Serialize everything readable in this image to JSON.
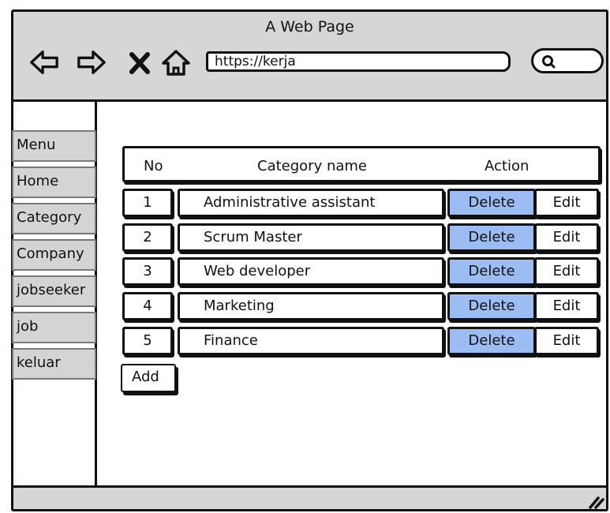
{
  "window": {
    "title": "A Web Page"
  },
  "address_bar": {
    "url": "https://kerja"
  },
  "icons": {
    "back": "arrow-left-icon",
    "forward": "arrow-right-icon",
    "stop": "close-icon",
    "home": "home-icon",
    "search": "search-icon",
    "resize": "resize-grip-icon"
  },
  "sidebar": {
    "items": [
      {
        "label": "Menu"
      },
      {
        "label": "Home"
      },
      {
        "label": "Category"
      },
      {
        "label": "Company"
      },
      {
        "label": "jobseeker"
      },
      {
        "label": "job"
      },
      {
        "label": "keluar"
      }
    ]
  },
  "table": {
    "headers": {
      "no": "No",
      "name": "Category name",
      "action": "Action"
    },
    "rows": [
      {
        "no": "1",
        "name": "Administrative assistant",
        "delete": "Delete",
        "edit": "Edit"
      },
      {
        "no": "2",
        "name": "Scrum Master",
        "delete": "Delete",
        "edit": "Edit"
      },
      {
        "no": "3",
        "name": "Web developer",
        "delete": "Delete",
        "edit": "Edit"
      },
      {
        "no": "4",
        "name": "Marketing",
        "delete": "Delete",
        "edit": "Edit"
      },
      {
        "no": "5",
        "name": "Finance",
        "delete": "Delete",
        "edit": "Edit"
      }
    ]
  },
  "add_button": {
    "label": "Add"
  },
  "colors": {
    "delete_bg": "#9bbdf3",
    "chrome_bg": "#d6d6d6",
    "menu_bg": "#d4d4d4"
  }
}
